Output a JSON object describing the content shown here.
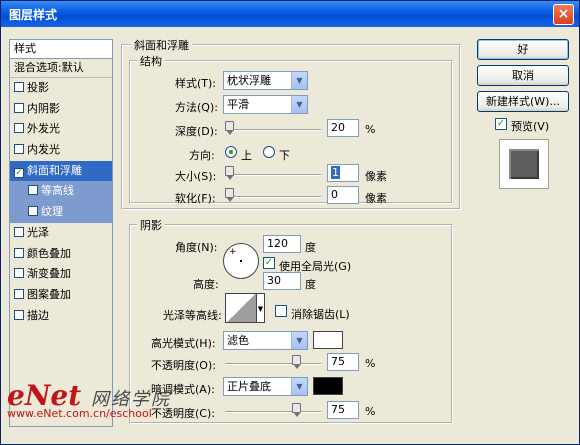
{
  "window": {
    "title": "图层样式",
    "close_glyph": "×"
  },
  "left_list": {
    "header": "样式",
    "blend": "混合选项:默认",
    "items": [
      {
        "label": "投影",
        "checked": false
      },
      {
        "label": "内阴影",
        "checked": false
      },
      {
        "label": "外发光",
        "checked": false
      },
      {
        "label": "内发光",
        "checked": false
      },
      {
        "label": "斜面和浮雕",
        "checked": true
      },
      {
        "label": "等高线",
        "checked": false
      },
      {
        "label": "纹理",
        "checked": false
      },
      {
        "label": "光泽",
        "checked": false
      },
      {
        "label": "颜色叠加",
        "checked": false
      },
      {
        "label": "渐变叠加",
        "checked": false
      },
      {
        "label": "图案叠加",
        "checked": false
      },
      {
        "label": "描边",
        "checked": false
      }
    ]
  },
  "bevel": {
    "group_title": "斜面和浮雕",
    "structure_title": "结构",
    "style_label": "样式(T):",
    "style_value": "枕状浮雕",
    "technique_label": "方法(Q):",
    "technique_value": "平滑",
    "depth_label": "深度(D):",
    "depth_value": "20",
    "depth_unit": "%",
    "depth_level": 0.0,
    "direction_label": "方向:",
    "direction_up": "上",
    "direction_down": "下",
    "size_label": "大小(S):",
    "size_value": "1",
    "size_unit": "像素",
    "soften_label": "软化(F):",
    "soften_value": "0",
    "soften_unit": "像素"
  },
  "shading": {
    "title": "阴影",
    "angle_label": "角度(N):",
    "angle_value": "120",
    "angle_unit": "度",
    "global_light_label": "使用全局光(G)",
    "altitude_label": "高度:",
    "altitude_value": "30",
    "altitude_unit": "度",
    "gloss_label": "光泽等高线:",
    "antialias_label": "消除锯齿(L)",
    "highlight_label": "高光模式(H):",
    "highlight_value": "滤色",
    "highlight_color": "#ffffff",
    "opacity_label": "不透明度(O):",
    "opacity_value": "75",
    "opacity_unit": "%",
    "shadow_label": "暗调模式(A):",
    "shadow_value": "正片叠底",
    "shadow_color": "#000000",
    "opacity2_label": "不透明度(C):",
    "opacity2_value": "75",
    "opacity2_unit": "%"
  },
  "buttons": {
    "ok": "好",
    "cancel": "取消",
    "new_style": "新建样式(W)...",
    "preview": "预览(V)"
  },
  "watermark": {
    "logo": "eNet",
    "cn": "网络学院",
    "url": "www.eNet.com.cn/eschool"
  }
}
